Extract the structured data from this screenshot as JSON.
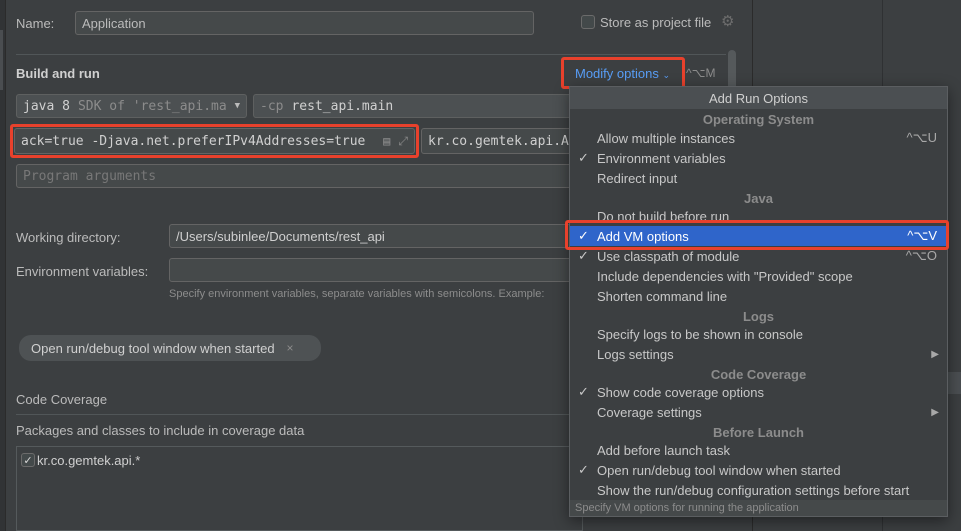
{
  "form": {
    "name_label": "Name:",
    "name_value": "Application",
    "store_label": "Store as project file",
    "build_run_title": "Build and run",
    "modify_options_label": "Modify options",
    "modify_options_shortcut": "^⌥M",
    "jdk_java": "java 8",
    "jdk_sdk": "SDK of 'rest_api.ma",
    "cp_prefix": "-cp",
    "cp_value": "rest_api.main",
    "vm_options_value": "ack=true -Djava.net.preferIPv4Addresses=true",
    "main_class_value": "kr.co.gemtek.api.A",
    "program_args_placeholder": "Program arguments",
    "working_dir_label": "Working directory:",
    "working_dir_value": "/Users/subinlee/Documents/rest_api",
    "env_vars_label": "Environment variables:",
    "env_vars_hint": "Specify environment variables, separate variables with semicolons. Example:",
    "chip_label": "Open run/debug tool window when started",
    "coverage_title": "Code Coverage",
    "coverage_packages_label": "Packages and classes to include in coverage data",
    "coverage_entry": "kr.co.gemtek.api.*"
  },
  "popup": {
    "title": "Add Run Options",
    "groups": {
      "os": "Operating System",
      "java": "Java",
      "logs": "Logs",
      "coverage": "Code Coverage",
      "before": "Before Launch"
    },
    "items": [
      {
        "label": "Allow multiple instances",
        "checked": "",
        "shortcut": "^⌥U"
      },
      {
        "label": "Environment variables",
        "checked": "✓",
        "shortcut": ""
      },
      {
        "label": "Redirect input",
        "checked": "",
        "shortcut": ""
      },
      {
        "label": "Do not build before run",
        "checked": "",
        "shortcut": ""
      },
      {
        "label": "Add VM options",
        "checked": "✓",
        "shortcut": "^⌥V"
      },
      {
        "label": "Use classpath of module",
        "checked": "✓",
        "shortcut": "^⌥O"
      },
      {
        "label": "Include dependencies with \"Provided\" scope",
        "checked": "",
        "shortcut": ""
      },
      {
        "label": "Shorten command line",
        "checked": "",
        "shortcut": ""
      },
      {
        "label": "Specify logs to be shown in console",
        "checked": "",
        "shortcut": ""
      },
      {
        "label": "Logs settings",
        "checked": "",
        "shortcut": "▶"
      },
      {
        "label": "Show code coverage options",
        "checked": "✓",
        "shortcut": ""
      },
      {
        "label": "Coverage settings",
        "checked": "",
        "shortcut": "▶"
      },
      {
        "label": "Add before launch task",
        "checked": "",
        "shortcut": ""
      },
      {
        "label": "Open run/debug tool window when started",
        "checked": "✓",
        "shortcut": ""
      },
      {
        "label": "Show the run/debug configuration settings before start",
        "checked": "",
        "shortcut": ""
      }
    ],
    "footer_hint": "Specify VM options for running the application"
  },
  "colors": {
    "accent_blue": "#589df6",
    "selection": "#2f65ca",
    "highlight_red": "#e8412c"
  }
}
